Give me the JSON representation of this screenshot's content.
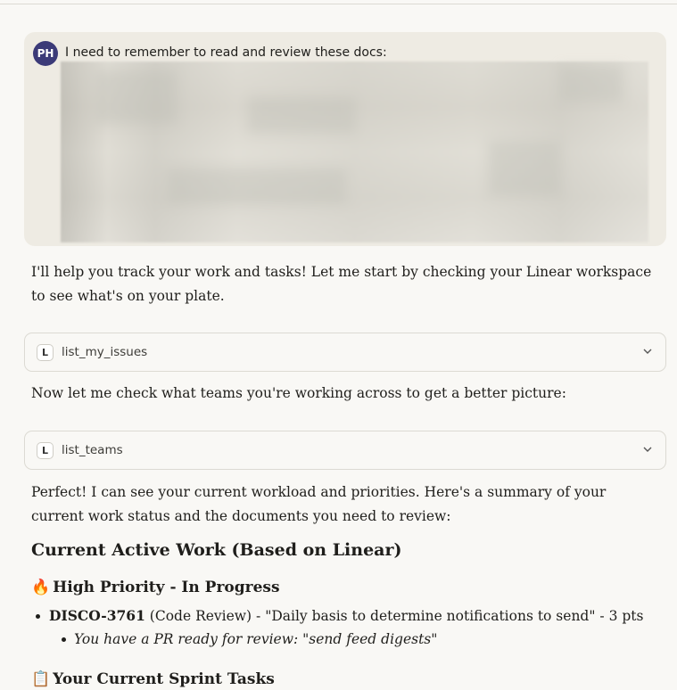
{
  "user_message": {
    "avatar_initials": "PH",
    "text": "I need to remember to read and review these docs:"
  },
  "assistant": {
    "intro": "I'll help you track your work and tasks! Let me start by checking your Linear workspace to see what's on your plate.",
    "tool_1": {
      "icon_letter": "L",
      "label": "list_my_issues"
    },
    "between": "Now let me check what teams you're working across to get a better picture:",
    "tool_2": {
      "icon_letter": "L",
      "label": "list_teams"
    },
    "summary": "Perfect! I can see your current workload and priorities. Here's a summary of your current work status and the documents you need to review:",
    "heading_main": "Current Active Work (Based on Linear)",
    "section_1": {
      "emoji": "🔥",
      "title": "High Priority - In Progress",
      "issue_id": "DISCO-3761",
      "issue_rest": " (Code Review) - \"Daily basis to determine notifications to send\" - 3 pts",
      "sub_item": "You have a PR ready for review: \"send feed digests\""
    },
    "section_2": {
      "emoji": "📋",
      "title": "Your Current Sprint Tasks"
    }
  },
  "colors": {
    "page_bg": "#f9f8f5",
    "user_bubble_bg": "#eeebe3",
    "avatar_bg": "#3b3a78",
    "border": "#dcdad3"
  }
}
